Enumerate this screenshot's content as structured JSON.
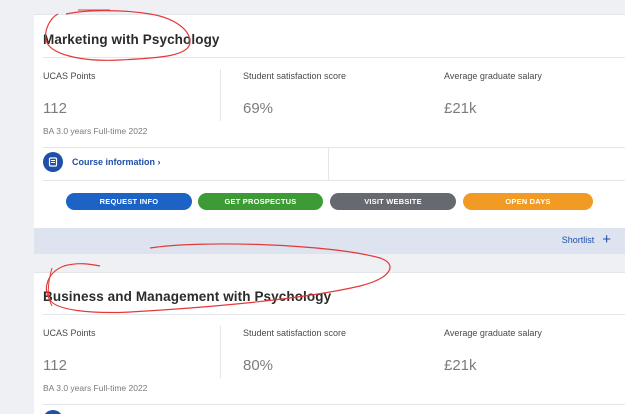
{
  "courses": [
    {
      "title": "Marketing with Psychology",
      "stats": [
        {
          "label": "UCAS Points",
          "value": "112"
        },
        {
          "label": "Student satisfaction score",
          "value": "69%"
        },
        {
          "label": "Average graduate salary",
          "value": "£21k"
        }
      ],
      "meta": "BA 3.0 years Full-time 2022",
      "course_info_label": "Course information ›",
      "buttons": {
        "request": "REQUEST INFO",
        "prospectus": "GET PROSPECTUS",
        "website": "VISIT WEBSITE",
        "opendays": "OPEN DAYS"
      }
    },
    {
      "title": "Business and Management with Psychology",
      "stats": [
        {
          "label": "UCAS Points",
          "value": "112"
        },
        {
          "label": "Student satisfaction score",
          "value": "80%"
        },
        {
          "label": "Average graduate salary",
          "value": "£21k"
        }
      ],
      "meta": "BA 3.0 years Full-time 2022"
    }
  ],
  "shortlist": {
    "label": "Shortlist",
    "icon": "plus-icon"
  },
  "colors": {
    "primary": "#1f4fa6",
    "request": "#1d63c5",
    "prospectus": "#3d9b35",
    "website": "#666a70",
    "opendays": "#f29b24",
    "annotation": "#e23a3a"
  }
}
